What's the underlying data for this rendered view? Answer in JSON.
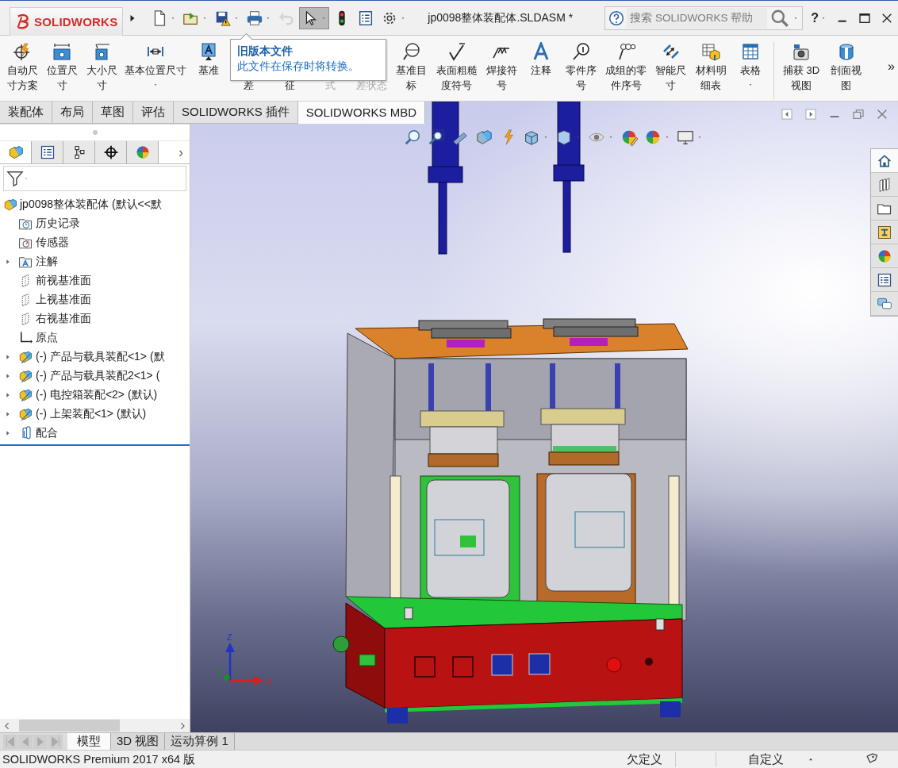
{
  "title_bar": {
    "logo": "SOLIDWORKS",
    "document_title": "jp0098整体装配体.SLDASM *",
    "search": {
      "placeholder": "搜索 SOLIDWORKS 帮助"
    },
    "help": "?",
    "quick_access": [
      {
        "disabled": false,
        "pressed": false
      },
      {
        "disabled": false,
        "pressed": false
      },
      {
        "disabled": false,
        "pressed": false
      },
      {
        "disabled": false,
        "pressed": false
      },
      {
        "disabled": true,
        "pressed": false
      },
      {
        "disabled": false,
        "pressed": true
      },
      {
        "disabled": false,
        "pressed": false
      },
      {
        "disabled": false,
        "pressed": false
      },
      {
        "disabled": false,
        "pressed": false
      }
    ]
  },
  "ribbon": {
    "groups": [
      {
        "items": [
          {
            "label": "自动尺寸方案",
            "kind": "button",
            "disabled": false
          },
          {
            "label": "位置尺寸",
            "kind": "button",
            "disabled": false
          },
          {
            "label": "大小尺寸",
            "kind": "button",
            "disabled": false
          },
          {
            "label": "基本位置尺寸",
            "kind": "dropdown",
            "disabled": false
          },
          {
            "label": "基准",
            "kind": "button",
            "disabled": false
          },
          {
            "label": "差",
            "kind": "covered",
            "disabled": false
          },
          {
            "label": "征",
            "kind": "covered",
            "disabled": false
          },
          {
            "label": "式",
            "kind": "covered",
            "disabled": true
          },
          {
            "label": "差状态",
            "kind": "covered",
            "disabled": true
          },
          {
            "label": "基准目标",
            "kind": "button",
            "disabled": false
          },
          {
            "label": "表面粗糙度符号",
            "kind": "button",
            "disabled": false
          },
          {
            "label": "焊接符号",
            "kind": "button",
            "disabled": false
          },
          {
            "label": "注释",
            "kind": "button",
            "disabled": false
          },
          {
            "label": "零件序号",
            "kind": "button",
            "disabled": false
          },
          {
            "label": "成组的零件序号",
            "kind": "button",
            "disabled": false
          },
          {
            "label": "智能尺寸",
            "kind": "button",
            "disabled": false
          },
          {
            "label": "材料明细表",
            "kind": "button",
            "disabled": false
          },
          {
            "label": "表格",
            "kind": "dropdown",
            "disabled": false
          }
        ]
      },
      {
        "items": [
          {
            "label": "捕获 3D 视图",
            "kind": "button",
            "disabled": false
          },
          {
            "label": "剖面视图",
            "kind": "button",
            "disabled": false
          }
        ]
      }
    ],
    "overflow": "»",
    "tooltip": {
      "title": "旧版本文件",
      "text": "此文件在保存时将转换。"
    }
  },
  "command_tabs": [
    {
      "label": "装配体",
      "selected": false
    },
    {
      "label": "布局",
      "selected": false
    },
    {
      "label": "草图",
      "selected": false
    },
    {
      "label": "评估",
      "selected": false
    },
    {
      "label": "SOLIDWORKS 插件",
      "selected": false
    },
    {
      "label": "SOLIDWORKS MBD",
      "selected": true
    }
  ],
  "feature_manager": {
    "panel_tabs": [
      {
        "selected": true
      },
      {
        "selected": false
      },
      {
        "selected": false
      },
      {
        "selected": false
      },
      {
        "selected": false
      }
    ],
    "more": "›",
    "tree": {
      "label": "jp0098整体装配体 (默认<<默",
      "kind": "assembly",
      "children": [
        {
          "label": "历史记录",
          "kind": "history"
        },
        {
          "label": "传感器",
          "kind": "sensor"
        },
        {
          "label": "注解",
          "kind": "annotation",
          "expanded": false
        },
        {
          "label": "前视基准面",
          "kind": "plane"
        },
        {
          "label": "上视基准面",
          "kind": "plane"
        },
        {
          "label": "右视基准面",
          "kind": "plane"
        },
        {
          "label": "原点",
          "kind": "origin"
        },
        {
          "label": "(-) 产品与载具装配<1> (默",
          "kind": "subassembly",
          "expanded": false
        },
        {
          "label": "(-) 产品与载具装配2<1> (",
          "kind": "subassembly",
          "expanded": false
        },
        {
          "label": "(-) 电控箱装配<2> (默认)",
          "kind": "subassembly",
          "expanded": false
        },
        {
          "label": "(-) 上架装配<1> (默认)",
          "kind": "subassembly",
          "expanded": false
        },
        {
          "label": "配合",
          "kind": "mates",
          "expanded": false
        }
      ]
    }
  },
  "triad": {
    "z": "Z",
    "x": "X",
    "y": "Y"
  },
  "bottom_tabs": [
    {
      "label": "模型",
      "selected": true
    },
    {
      "label": "3D 视图",
      "selected": false
    },
    {
      "label": "运动算例 1",
      "selected": false
    }
  ],
  "status_bar": {
    "product": "SOLIDWORKS Premium 2017 x64 版",
    "state": "欠定义",
    "units": "自定义"
  }
}
